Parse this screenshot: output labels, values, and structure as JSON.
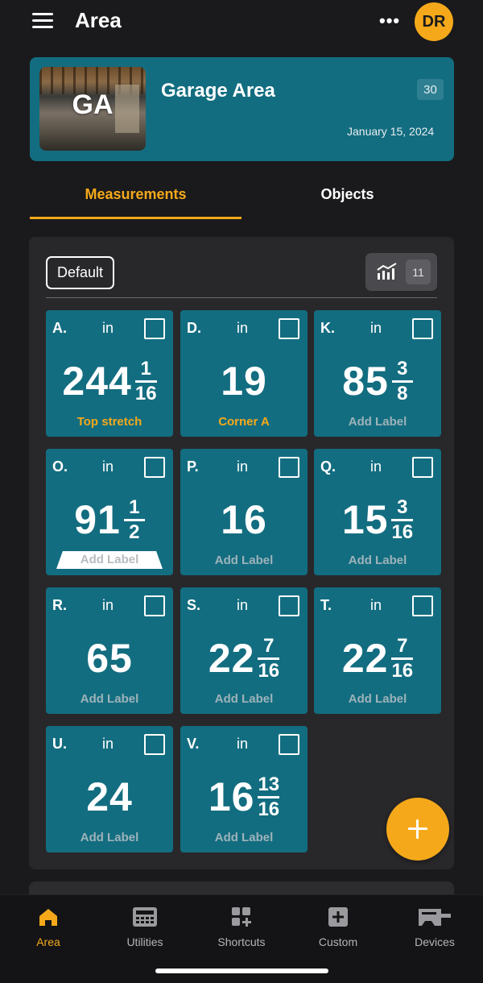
{
  "header": {
    "title": "Area",
    "more_label": "•••",
    "avatar_initials": "DR"
  },
  "area": {
    "name": "Garage Area",
    "thumb_initials": "GA",
    "count": "30",
    "date": "January 15, 2024"
  },
  "tabs": [
    {
      "label": "Measurements",
      "active": true
    },
    {
      "label": "Objects",
      "active": false
    }
  ],
  "panel": {
    "filter_label": "Default",
    "stats_count": "11"
  },
  "measurements": [
    {
      "letter": "A.",
      "unit": "in",
      "whole": "244",
      "num": "1",
      "den": "16",
      "label": "Top stretch"
    },
    {
      "letter": "D.",
      "unit": "in",
      "whole": "19",
      "num": "",
      "den": "",
      "label": "Corner A"
    },
    {
      "letter": "K.",
      "unit": "in",
      "whole": "85",
      "num": "3",
      "den": "8",
      "label": "Add Label"
    },
    {
      "letter": "O.",
      "unit": "in",
      "whole": "91",
      "num": "1",
      "den": "2",
      "label": "Add Label"
    },
    {
      "letter": "P.",
      "unit": "in",
      "whole": "16",
      "num": "",
      "den": "",
      "label": "Add Label"
    },
    {
      "letter": "Q.",
      "unit": "in",
      "whole": "15",
      "num": "3",
      "den": "16",
      "label": "Add Label"
    },
    {
      "letter": "R.",
      "unit": "in",
      "whole": "65",
      "num": "",
      "den": "",
      "label": "Add Label"
    },
    {
      "letter": "S.",
      "unit": "in",
      "whole": "22",
      "num": "7",
      "den": "16",
      "label": "Add Label"
    },
    {
      "letter": "T.",
      "unit": "in",
      "whole": "22",
      "num": "7",
      "den": "16",
      "label": "Add Label"
    },
    {
      "letter": "U.",
      "unit": "in",
      "whole": "24",
      "num": "",
      "den": "",
      "label": "Add Label"
    },
    {
      "letter": "V.",
      "unit": "in",
      "whole": "16",
      "num": "13",
      "den": "16",
      "label": "Add Label"
    }
  ],
  "bottom_nav": [
    {
      "label": "Area",
      "icon": "home-icon",
      "active": true
    },
    {
      "label": "Utilities",
      "icon": "calculator-icon",
      "active": false
    },
    {
      "label": "Shortcuts",
      "icon": "shortcuts-grid-icon",
      "active": false
    },
    {
      "label": "Custom",
      "icon": "plus-square-icon",
      "active": false
    },
    {
      "label": "Devices",
      "icon": "tape-measure-icon",
      "active": false
    }
  ],
  "colors": {
    "accent": "#f5a91a",
    "tile": "#136d80",
    "background": "#1a1a1c",
    "panel": "#28272a"
  }
}
